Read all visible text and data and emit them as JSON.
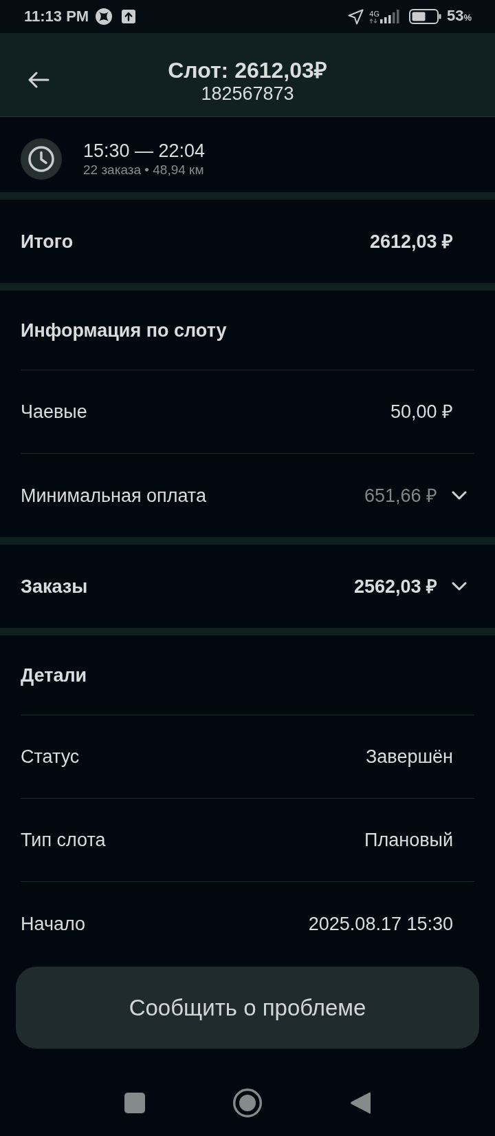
{
  "status_bar": {
    "time": "11:13 PM",
    "network_type": "4G",
    "battery_percent": "53",
    "battery_unit": "%"
  },
  "header": {
    "title": "Слот: 2612,03₽",
    "subtitle": "182567873"
  },
  "slot_time": {
    "range": "15:30 — 22:04",
    "summary": "22 заказа • 48,94 км"
  },
  "sections": [
    {
      "rows": [
        {
          "kind": "strong",
          "label": "Итого",
          "value": "2612,03 ₽"
        }
      ]
    },
    {
      "title": "Информация по слоту",
      "rows": [
        {
          "kind": "regular",
          "label": "Чаевые",
          "value": "50,00 ₽"
        },
        {
          "kind": "dimmed",
          "label": "Минимальная оплата",
          "value": "651,66 ₽",
          "expanded": false
        }
      ]
    },
    {
      "rows": [
        {
          "kind": "strong",
          "label": "Заказы",
          "value": "2562,03 ₽",
          "expanded": false
        }
      ]
    },
    {
      "title": "Детали",
      "rows": [
        {
          "kind": "regular",
          "label": "Статус",
          "value": "Завершён"
        },
        {
          "kind": "regular",
          "label": "Тип слота",
          "value": "Плановый"
        },
        {
          "kind": "regular",
          "label": "Начало",
          "value": "2025.08.17 15:30"
        }
      ]
    }
  ],
  "report_button": {
    "label": "Сообщить о проблеме"
  }
}
